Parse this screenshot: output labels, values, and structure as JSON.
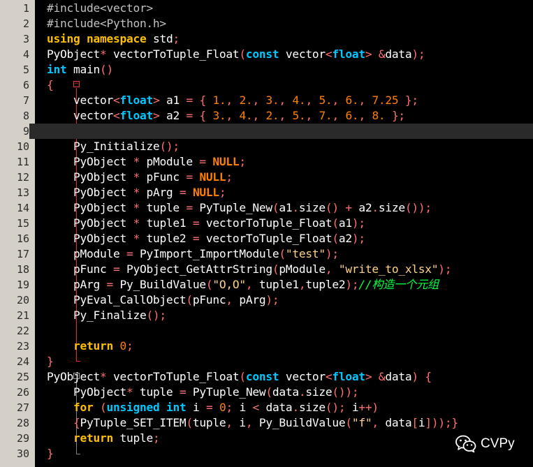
{
  "editor": {
    "current_line": 9,
    "colors": {
      "background": "#000000",
      "gutter": "#d4d0c8",
      "keyword": "#ffc000",
      "type": "#00c8ff",
      "operator": "#ff7070",
      "number": "#ff8000",
      "string": "#ffd28c",
      "comment": "#00ff40",
      "fold_marker": "#ff3030"
    },
    "lines": [
      {
        "n": "1",
        "tokens": [
          [
            "pp",
            "#include<vector>"
          ]
        ]
      },
      {
        "n": "2",
        "tokens": [
          [
            "pp",
            "#include<Python.h>"
          ]
        ]
      },
      {
        "n": "3",
        "tokens": [
          [
            "kw",
            "using"
          ],
          [
            "t",
            " "
          ],
          [
            "kw",
            "namespace"
          ],
          [
            "t",
            " std"
          ],
          [
            "op",
            ";"
          ]
        ]
      },
      {
        "n": "4",
        "tokens": [
          [
            "t",
            "PyObject"
          ],
          [
            "op",
            "*"
          ],
          [
            "t",
            " vectorToTuple_Float"
          ],
          [
            "op",
            "("
          ],
          [
            "ty",
            "const"
          ],
          [
            "t",
            " vector"
          ],
          [
            "op",
            "<"
          ],
          [
            "ty",
            "float"
          ],
          [
            "op",
            ">"
          ],
          [
            "t",
            " "
          ],
          [
            "op",
            "&"
          ],
          [
            "t",
            "data"
          ],
          [
            "op",
            ");"
          ]
        ]
      },
      {
        "n": "5",
        "tokens": [
          [
            "ty",
            "int"
          ],
          [
            "t",
            " main"
          ],
          [
            "op",
            "()"
          ]
        ]
      },
      {
        "n": "6",
        "tokens": [
          [
            "op",
            "{"
          ]
        ]
      },
      {
        "n": "7",
        "tokens": [
          [
            "t",
            "    vector"
          ],
          [
            "op",
            "<"
          ],
          [
            "ty",
            "float"
          ],
          [
            "op",
            ">"
          ],
          [
            "t",
            " a1 "
          ],
          [
            "op",
            "="
          ],
          [
            "t",
            " "
          ],
          [
            "op",
            "{"
          ],
          [
            "t",
            " "
          ],
          [
            "num",
            "1."
          ],
          [
            "op",
            ","
          ],
          [
            "t",
            " "
          ],
          [
            "num",
            "2."
          ],
          [
            "op",
            ","
          ],
          [
            "t",
            " "
          ],
          [
            "num",
            "3."
          ],
          [
            "op",
            ","
          ],
          [
            "t",
            " "
          ],
          [
            "num",
            "4."
          ],
          [
            "op",
            ","
          ],
          [
            "t",
            " "
          ],
          [
            "num",
            "5."
          ],
          [
            "op",
            ","
          ],
          [
            "t",
            " "
          ],
          [
            "num",
            "6."
          ],
          [
            "op",
            ","
          ],
          [
            "t",
            " "
          ],
          [
            "num",
            "7.25"
          ],
          [
            "t",
            " "
          ],
          [
            "op",
            "};"
          ]
        ]
      },
      {
        "n": "8",
        "tokens": [
          [
            "t",
            "    vector"
          ],
          [
            "op",
            "<"
          ],
          [
            "ty",
            "float"
          ],
          [
            "op",
            ">"
          ],
          [
            "t",
            " a2 "
          ],
          [
            "op",
            "="
          ],
          [
            "t",
            " "
          ],
          [
            "op",
            "{"
          ],
          [
            "t",
            " "
          ],
          [
            "num",
            "3."
          ],
          [
            "op",
            ","
          ],
          [
            "t",
            " "
          ],
          [
            "num",
            "4."
          ],
          [
            "op",
            ","
          ],
          [
            "t",
            " "
          ],
          [
            "num",
            "2."
          ],
          [
            "op",
            ","
          ],
          [
            "t",
            " "
          ],
          [
            "num",
            "5."
          ],
          [
            "op",
            ","
          ],
          [
            "t",
            " "
          ],
          [
            "num",
            "7."
          ],
          [
            "op",
            ","
          ],
          [
            "t",
            " "
          ],
          [
            "num",
            "6."
          ],
          [
            "op",
            ","
          ],
          [
            "t",
            " "
          ],
          [
            "num",
            "8."
          ],
          [
            "t",
            " "
          ],
          [
            "op",
            "};"
          ]
        ]
      },
      {
        "n": "9",
        "tokens": []
      },
      {
        "n": "10",
        "tokens": [
          [
            "t",
            "    Py_Initialize"
          ],
          [
            "op",
            "();"
          ]
        ]
      },
      {
        "n": "11",
        "tokens": [
          [
            "t",
            "    PyObject "
          ],
          [
            "op",
            "*"
          ],
          [
            "t",
            " pModule "
          ],
          [
            "op",
            "="
          ],
          [
            "t",
            " "
          ],
          [
            "nul",
            "NULL"
          ],
          [
            "op",
            ";"
          ]
        ]
      },
      {
        "n": "12",
        "tokens": [
          [
            "t",
            "    PyObject "
          ],
          [
            "op",
            "*"
          ],
          [
            "t",
            " pFunc "
          ],
          [
            "op",
            "="
          ],
          [
            "t",
            " "
          ],
          [
            "nul",
            "NULL"
          ],
          [
            "op",
            ";"
          ]
        ]
      },
      {
        "n": "13",
        "tokens": [
          [
            "t",
            "    PyObject "
          ],
          [
            "op",
            "*"
          ],
          [
            "t",
            " pArg "
          ],
          [
            "op",
            "="
          ],
          [
            "t",
            " "
          ],
          [
            "nul",
            "NULL"
          ],
          [
            "op",
            ";"
          ]
        ]
      },
      {
        "n": "14",
        "tokens": [
          [
            "t",
            "    PyObject "
          ],
          [
            "op",
            "*"
          ],
          [
            "t",
            " tuple "
          ],
          [
            "op",
            "="
          ],
          [
            "t",
            " PyTuple_New"
          ],
          [
            "op",
            "("
          ],
          [
            "t",
            "a1"
          ],
          [
            "op",
            "."
          ],
          [
            "t",
            "size"
          ],
          [
            "op",
            "()"
          ],
          [
            "t",
            " "
          ],
          [
            "op",
            "+"
          ],
          [
            "t",
            " a2"
          ],
          [
            "op",
            "."
          ],
          [
            "t",
            "size"
          ],
          [
            "op",
            "());"
          ]
        ]
      },
      {
        "n": "15",
        "tokens": [
          [
            "t",
            "    PyObject "
          ],
          [
            "op",
            "*"
          ],
          [
            "t",
            " tuple1 "
          ],
          [
            "op",
            "="
          ],
          [
            "t",
            " vectorToTuple_Float"
          ],
          [
            "op",
            "("
          ],
          [
            "t",
            "a1"
          ],
          [
            "op",
            ");"
          ]
        ]
      },
      {
        "n": "16",
        "tokens": [
          [
            "t",
            "    PyObject "
          ],
          [
            "op",
            "*"
          ],
          [
            "t",
            " tuple2 "
          ],
          [
            "op",
            "="
          ],
          [
            "t",
            " vectorToTuple_Float"
          ],
          [
            "op",
            "("
          ],
          [
            "t",
            "a2"
          ],
          [
            "op",
            ");"
          ]
        ]
      },
      {
        "n": "17",
        "tokens": [
          [
            "t",
            "    pModule "
          ],
          [
            "op",
            "="
          ],
          [
            "t",
            " PyImport_ImportModule"
          ],
          [
            "op",
            "("
          ],
          [
            "str",
            "\"test\""
          ],
          [
            "op",
            ");"
          ]
        ]
      },
      {
        "n": "18",
        "tokens": [
          [
            "t",
            "    pFunc "
          ],
          [
            "op",
            "="
          ],
          [
            "t",
            " PyObject_GetAttrString"
          ],
          [
            "op",
            "("
          ],
          [
            "t",
            "pModule"
          ],
          [
            "op",
            ","
          ],
          [
            "t",
            " "
          ],
          [
            "str",
            "\"write_to_xlsx\""
          ],
          [
            "op",
            ");"
          ]
        ]
      },
      {
        "n": "19",
        "tokens": [
          [
            "t",
            "    pArg "
          ],
          [
            "op",
            "="
          ],
          [
            "t",
            " Py_BuildValue"
          ],
          [
            "op",
            "("
          ],
          [
            "str",
            "\"O,O\""
          ],
          [
            "op",
            ","
          ],
          [
            "t",
            " tuple1"
          ],
          [
            "op",
            ","
          ],
          [
            "t",
            "tuple2"
          ],
          [
            "op",
            ");"
          ],
          [
            "cm",
            "//"
          ],
          [
            "cmz",
            "构造一个元组"
          ]
        ]
      },
      {
        "n": "20",
        "tokens": [
          [
            "t",
            "    PyEval_CallObject"
          ],
          [
            "op",
            "("
          ],
          [
            "t",
            "pFunc"
          ],
          [
            "op",
            ","
          ],
          [
            "t",
            " pArg"
          ],
          [
            "op",
            ");"
          ]
        ]
      },
      {
        "n": "21",
        "tokens": [
          [
            "t",
            "    Py_Finalize"
          ],
          [
            "op",
            "();"
          ]
        ]
      },
      {
        "n": "22",
        "tokens": []
      },
      {
        "n": "23",
        "tokens": [
          [
            "t",
            "    "
          ],
          [
            "kw",
            "return"
          ],
          [
            "t",
            " "
          ],
          [
            "num",
            "0"
          ],
          [
            "op",
            ";"
          ]
        ]
      },
      {
        "n": "24",
        "tokens": [
          [
            "op",
            "}"
          ]
        ]
      },
      {
        "n": "25",
        "tokens": [
          [
            "t",
            "PyObject"
          ],
          [
            "op",
            "*"
          ],
          [
            "t",
            " vectorToTuple_Float"
          ],
          [
            "op",
            "("
          ],
          [
            "ty",
            "const"
          ],
          [
            "t",
            " vector"
          ],
          [
            "op",
            "<"
          ],
          [
            "ty",
            "float"
          ],
          [
            "op",
            ">"
          ],
          [
            "t",
            " "
          ],
          [
            "op",
            "&"
          ],
          [
            "t",
            "data"
          ],
          [
            "op",
            ")"
          ],
          [
            "t",
            " "
          ],
          [
            "op",
            "{"
          ]
        ]
      },
      {
        "n": "26",
        "tokens": [
          [
            "t",
            "    PyObject"
          ],
          [
            "op",
            "*"
          ],
          [
            "t",
            " tuple "
          ],
          [
            "op",
            "="
          ],
          [
            "t",
            " PyTuple_New"
          ],
          [
            "op",
            "("
          ],
          [
            "t",
            "data"
          ],
          [
            "op",
            "."
          ],
          [
            "t",
            "size"
          ],
          [
            "op",
            "());"
          ]
        ]
      },
      {
        "n": "27",
        "tokens": [
          [
            "t",
            "    "
          ],
          [
            "kw",
            "for"
          ],
          [
            "t",
            " "
          ],
          [
            "op",
            "("
          ],
          [
            "ty",
            "unsigned"
          ],
          [
            "t",
            " "
          ],
          [
            "ty",
            "int"
          ],
          [
            "t",
            " i "
          ],
          [
            "op",
            "="
          ],
          [
            "t",
            " "
          ],
          [
            "num",
            "0"
          ],
          [
            "op",
            ";"
          ],
          [
            "t",
            " i "
          ],
          [
            "op",
            "<"
          ],
          [
            "t",
            " data"
          ],
          [
            "op",
            "."
          ],
          [
            "t",
            "size"
          ],
          [
            "op",
            "();"
          ],
          [
            "t",
            " i"
          ],
          [
            "op",
            "++)"
          ]
        ]
      },
      {
        "n": "28",
        "tokens": [
          [
            "t",
            "    "
          ],
          [
            "op",
            "{"
          ],
          [
            "t",
            "PyTuple_SET_ITEM"
          ],
          [
            "op",
            "("
          ],
          [
            "t",
            "tuple"
          ],
          [
            "op",
            ","
          ],
          [
            "t",
            " i"
          ],
          [
            "op",
            ","
          ],
          [
            "t",
            " Py_BuildValue"
          ],
          [
            "op",
            "("
          ],
          [
            "str",
            "\"f\""
          ],
          [
            "op",
            ","
          ],
          [
            "t",
            " data"
          ],
          [
            "op",
            "["
          ],
          [
            "t",
            "i"
          ],
          [
            "op",
            "]));}"
          ]
        ]
      },
      {
        "n": "29",
        "tokens": [
          [
            "t",
            "    "
          ],
          [
            "kw",
            "return"
          ],
          [
            "t",
            " tuple"
          ],
          [
            "op",
            ";"
          ]
        ]
      },
      {
        "n": "30",
        "tokens": [
          [
            "op",
            "}"
          ]
        ]
      }
    ]
  },
  "watermark": {
    "icon": "wechat-icon",
    "text": "CVPy"
  }
}
